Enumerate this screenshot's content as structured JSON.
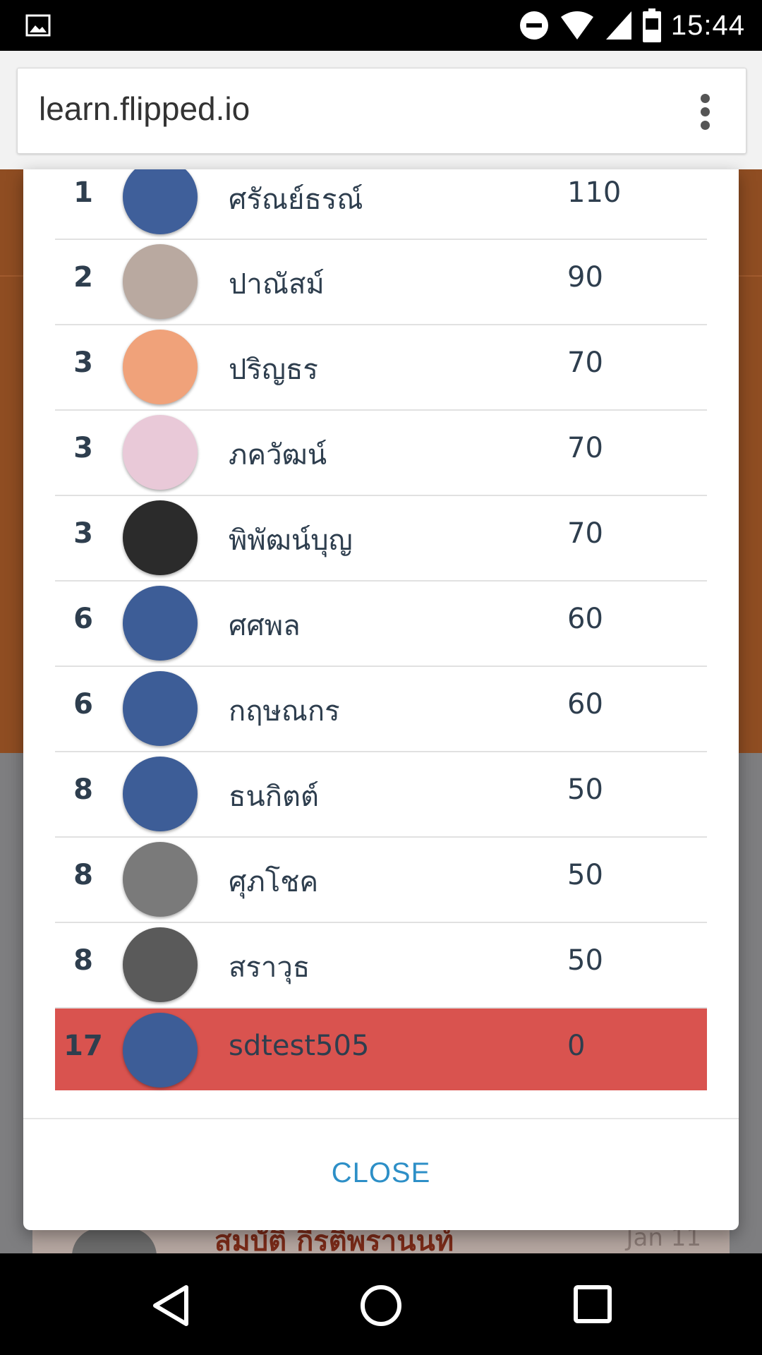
{
  "status_bar": {
    "time": "15:44"
  },
  "browser": {
    "url": "learn.flipped.io"
  },
  "leaderboard": {
    "rows": [
      {
        "rank": "1",
        "name": "ศรัณย์ธรณ์",
        "score": "110",
        "avatar_color": "#3f5f9a"
      },
      {
        "rank": "2",
        "name": "ปาณัสม์",
        "score": "90",
        "avatar_color": "#b9a9a0"
      },
      {
        "rank": "3",
        "name": "ปริญธร",
        "score": "70",
        "avatar_color": "#f0a27a"
      },
      {
        "rank": "3",
        "name": "ภควัฒน์",
        "score": "70",
        "avatar_color": "#e9c9d8"
      },
      {
        "rank": "3",
        "name": "พิพัฒน์บุญ",
        "score": "70",
        "avatar_color": "#2b2b2b"
      },
      {
        "rank": "6",
        "name": "ศศพล",
        "score": "60",
        "avatar_color": "#3d5d97"
      },
      {
        "rank": "6",
        "name": "กฤษณกร",
        "score": "60",
        "avatar_color": "#3d5d97"
      },
      {
        "rank": "8",
        "name": "ธนกิตต์",
        "score": "50",
        "avatar_color": "#3d5d97"
      },
      {
        "rank": "8",
        "name": "ศุภโชค",
        "score": "50",
        "avatar_color": "#7a7a7a"
      },
      {
        "rank": "8",
        "name": "สราวุธ",
        "score": "50",
        "avatar_color": "#5a5a5a"
      }
    ],
    "current_user": {
      "rank": "17",
      "name": "sdtest505",
      "score": "0",
      "avatar_color": "#3d5d97",
      "highlight_color": "#d9534f"
    }
  },
  "modal": {
    "close_label": "CLOSE"
  },
  "background_page": {
    "name": "สมบัติ กีรติพรานนท์",
    "date": "Jan 11"
  }
}
